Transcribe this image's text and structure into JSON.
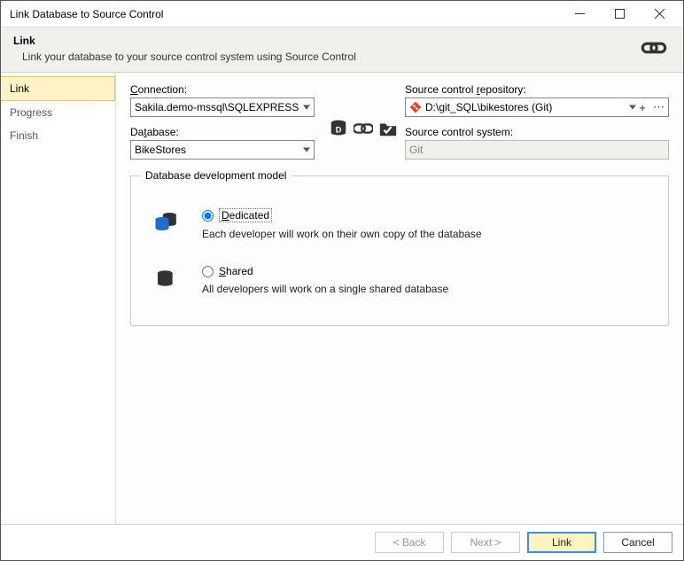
{
  "window": {
    "title": "Link Database to Source Control"
  },
  "header": {
    "title": "Link",
    "subtitle": "Link your database to your source control system using Source Control"
  },
  "sidebar": {
    "items": [
      {
        "label": "Link",
        "active": true
      },
      {
        "label": "Progress",
        "active": false
      },
      {
        "label": "Finish",
        "active": false
      }
    ]
  },
  "fields": {
    "connection_label": "Connection:",
    "connection_value": "Sakila.demo-mssql\\SQLEXPRESS",
    "database_label": "Database:",
    "database_value": "BikeStores",
    "repo_label": "Source control repository:",
    "repo_value": "D:\\git_SQL\\bikestores (Git)",
    "system_label": "Source control system:",
    "system_value": "Git"
  },
  "group": {
    "title": "Database development model",
    "dedicated": {
      "label_prefix": "D",
      "label_rest": "edicated",
      "desc": "Each developer will work on their own copy of the database",
      "selected": true
    },
    "shared": {
      "label_prefix": "S",
      "label_rest": "hared",
      "desc": "All developers will work on a single shared database",
      "selected": false
    }
  },
  "buttons": {
    "back": "< Back",
    "next": "Next >",
    "link": "Link",
    "cancel": "Cancel"
  }
}
